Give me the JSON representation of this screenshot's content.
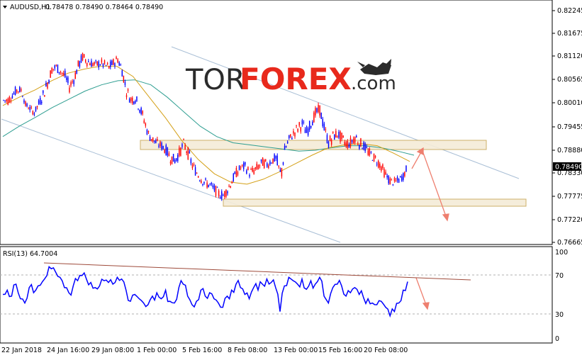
{
  "header": {
    "symbol_label": "AUDUSD,H1",
    "ohlc": "0.78478 0.78490 0.78464 0.78490"
  },
  "watermark": {
    "part1": "TOR",
    "part2": "FOREX",
    "part3": ".com"
  },
  "price_axis": {
    "ticks": [
      "0.82245",
      "0.81675",
      "0.81120",
      "0.80565",
      "0.80010",
      "0.79455",
      "0.78880",
      "0.78330",
      "0.77775",
      "0.77220",
      "0.76665"
    ],
    "current_price": "0.78490"
  },
  "rsi": {
    "label": "RSI(13) 64.7004",
    "ticks": [
      "100",
      "70",
      "30",
      "0"
    ]
  },
  "time_axis": {
    "labels": [
      "22 Jan 2018",
      "24 Jan 16:00",
      "29 Jan 08:00",
      "1 Feb 00:00",
      "5 Feb 16:00",
      "8 Feb 08:00",
      "13 Feb 00:00",
      "15 Feb 16:00",
      "20 Feb 08:00"
    ]
  },
  "colors": {
    "bull": "#0000ff",
    "bear": "#ff0000",
    "ma_fast": "#d4a017",
    "ma_slow": "#2e9e91",
    "channel": "#a9bfd6",
    "arrow": "#ee7f6f",
    "brand_red": "#e8291c",
    "brand_dark": "#2b2b2b"
  },
  "chart_data": {
    "type": "candlestick",
    "symbol": "AUDUSD",
    "timeframe": "H1",
    "ylim": [
      0.7663,
      0.8238
    ],
    "price_path": [
      [
        0.7995,
        0.801
      ],
      [
        0.799,
        0.8015
      ],
      [
        0.8005,
        0.8025
      ],
      [
        0.8015,
        0.804
      ],
      [
        0.802,
        0.8035
      ],
      [
        0.7985,
        0.8
      ],
      [
        0.7975,
        0.799
      ],
      [
        0.7965,
        0.798
      ],
      [
        0.7985,
        0.8005
      ],
      [
        0.8,
        0.803
      ],
      [
        0.803,
        0.806
      ],
      [
        0.8065,
        0.809
      ],
      [
        0.807,
        0.8095
      ],
      [
        0.806,
        0.8085
      ],
      [
        0.8045,
        0.8075
      ],
      [
        0.802,
        0.805
      ],
      [
        0.804,
        0.807
      ],
      [
        0.807,
        0.81
      ],
      [
        0.8095,
        0.812
      ],
      [
        0.8085,
        0.811
      ],
      [
        0.808,
        0.8105
      ],
      [
        0.8075,
        0.81
      ],
      [
        0.808,
        0.8105
      ],
      [
        0.8075,
        0.81
      ],
      [
        0.807,
        0.8095
      ],
      [
        0.808,
        0.8105
      ],
      [
        0.809,
        0.8115
      ],
      [
        0.806,
        0.809
      ],
      [
        0.801,
        0.804
      ],
      [
        0.799,
        0.802
      ],
      [
        0.7995,
        0.802
      ],
      [
        0.797,
        0.8
      ],
      [
        0.794,
        0.797
      ],
      [
        0.7905,
        0.7935
      ],
      [
        0.7895,
        0.792
      ],
      [
        0.7885,
        0.791
      ],
      [
        0.788,
        0.7905
      ],
      [
        0.787,
        0.7895
      ],
      [
        0.785,
        0.788
      ],
      [
        0.7845,
        0.787
      ],
      [
        0.786,
        0.789
      ],
      [
        0.7885,
        0.791
      ],
      [
        0.786,
        0.789
      ],
      [
        0.783,
        0.786
      ],
      [
        0.7815,
        0.784
      ],
      [
        0.78,
        0.7825
      ],
      [
        0.779,
        0.7815
      ],
      [
        0.7785,
        0.781
      ],
      [
        0.7775,
        0.78
      ],
      [
        0.7765,
        0.779
      ],
      [
        0.776,
        0.7785
      ],
      [
        0.7775,
        0.78
      ],
      [
        0.7795,
        0.782
      ],
      [
        0.7815,
        0.784
      ],
      [
        0.783,
        0.785
      ],
      [
        0.783,
        0.7855
      ],
      [
        0.7815,
        0.784
      ],
      [
        0.782,
        0.7845
      ],
      [
        0.783,
        0.7855
      ],
      [
        0.784,
        0.7865
      ],
      [
        0.7835,
        0.786
      ],
      [
        0.7845,
        0.787
      ],
      [
        0.785,
        0.7875
      ],
      [
        0.777,
        0.786
      ],
      [
        0.787,
        0.7895
      ],
      [
        0.7895,
        0.792
      ],
      [
        0.791,
        0.7935
      ],
      [
        0.792,
        0.795
      ],
      [
        0.793,
        0.796
      ],
      [
        0.791,
        0.794
      ],
      [
        0.7935,
        0.796
      ],
      [
        0.7955,
        0.7985
      ],
      [
        0.7965,
        0.7995
      ],
      [
        0.792,
        0.795
      ],
      [
        0.7885,
        0.7915
      ],
      [
        0.79,
        0.793
      ],
      [
        0.791,
        0.7935
      ],
      [
        0.7895,
        0.7925
      ],
      [
        0.7885,
        0.791
      ],
      [
        0.7885,
        0.7915
      ],
      [
        0.79,
        0.793
      ],
      [
        0.7885,
        0.7915
      ],
      [
        0.788,
        0.7905
      ],
      [
        0.7865,
        0.789
      ],
      [
        0.7855,
        0.788
      ],
      [
        0.7845,
        0.787
      ],
      [
        0.783,
        0.7855
      ],
      [
        0.781,
        0.7835
      ],
      [
        0.7795,
        0.782
      ],
      [
        0.7795,
        0.7815
      ],
      [
        0.78,
        0.782
      ],
      [
        0.781,
        0.783
      ],
      [
        0.783,
        0.7855
      ]
    ],
    "moving_averages": {
      "fast_path": [
        0.799,
        0.801,
        0.8028,
        0.805,
        0.8068,
        0.8078,
        0.8085,
        0.8085,
        0.806,
        0.801,
        0.796,
        0.7905,
        0.786,
        0.7825,
        0.7805,
        0.78,
        0.7812,
        0.783,
        0.785,
        0.787,
        0.7888,
        0.7895,
        0.7898,
        0.7893,
        0.7875,
        0.7855
      ],
      "slow_path": [
        0.7915,
        0.794,
        0.7962,
        0.7985,
        0.8005,
        0.8025,
        0.804,
        0.805,
        0.8052,
        0.804,
        0.801,
        0.7975,
        0.794,
        0.7915,
        0.79,
        0.7895,
        0.789,
        0.7885,
        0.788,
        0.7882,
        0.7888,
        0.7893,
        0.7893,
        0.7888,
        0.788,
        0.787
      ]
    },
    "resistance_zone": [
      0.7885,
      0.7905
    ],
    "support_zone": [
      0.7755,
      0.7772
    ],
    "rsi_ylim": [
      0,
      100
    ],
    "rsi_values": [
      50,
      55,
      48,
      62,
      45,
      40,
      58,
      52,
      60,
      65,
      72,
      80,
      76,
      70,
      58,
      52,
      60,
      66,
      72,
      68,
      64,
      58,
      60,
      66,
      64,
      62,
      70,
      68,
      55,
      42,
      50,
      45,
      40,
      38,
      48,
      52,
      45,
      55,
      42,
      40,
      58,
      62,
      48,
      38,
      42,
      55,
      48,
      52,
      45,
      40,
      35,
      48,
      55,
      62,
      58,
      50,
      45,
      58,
      55,
      62,
      68,
      64,
      58,
      30,
      60,
      70,
      66,
      62,
      68,
      56,
      66,
      62,
      70,
      48,
      40,
      58,
      62,
      60,
      48,
      52,
      58,
      50,
      46,
      45,
      40,
      38,
      42,
      35,
      25,
      30,
      40,
      55,
      65
    ]
  }
}
